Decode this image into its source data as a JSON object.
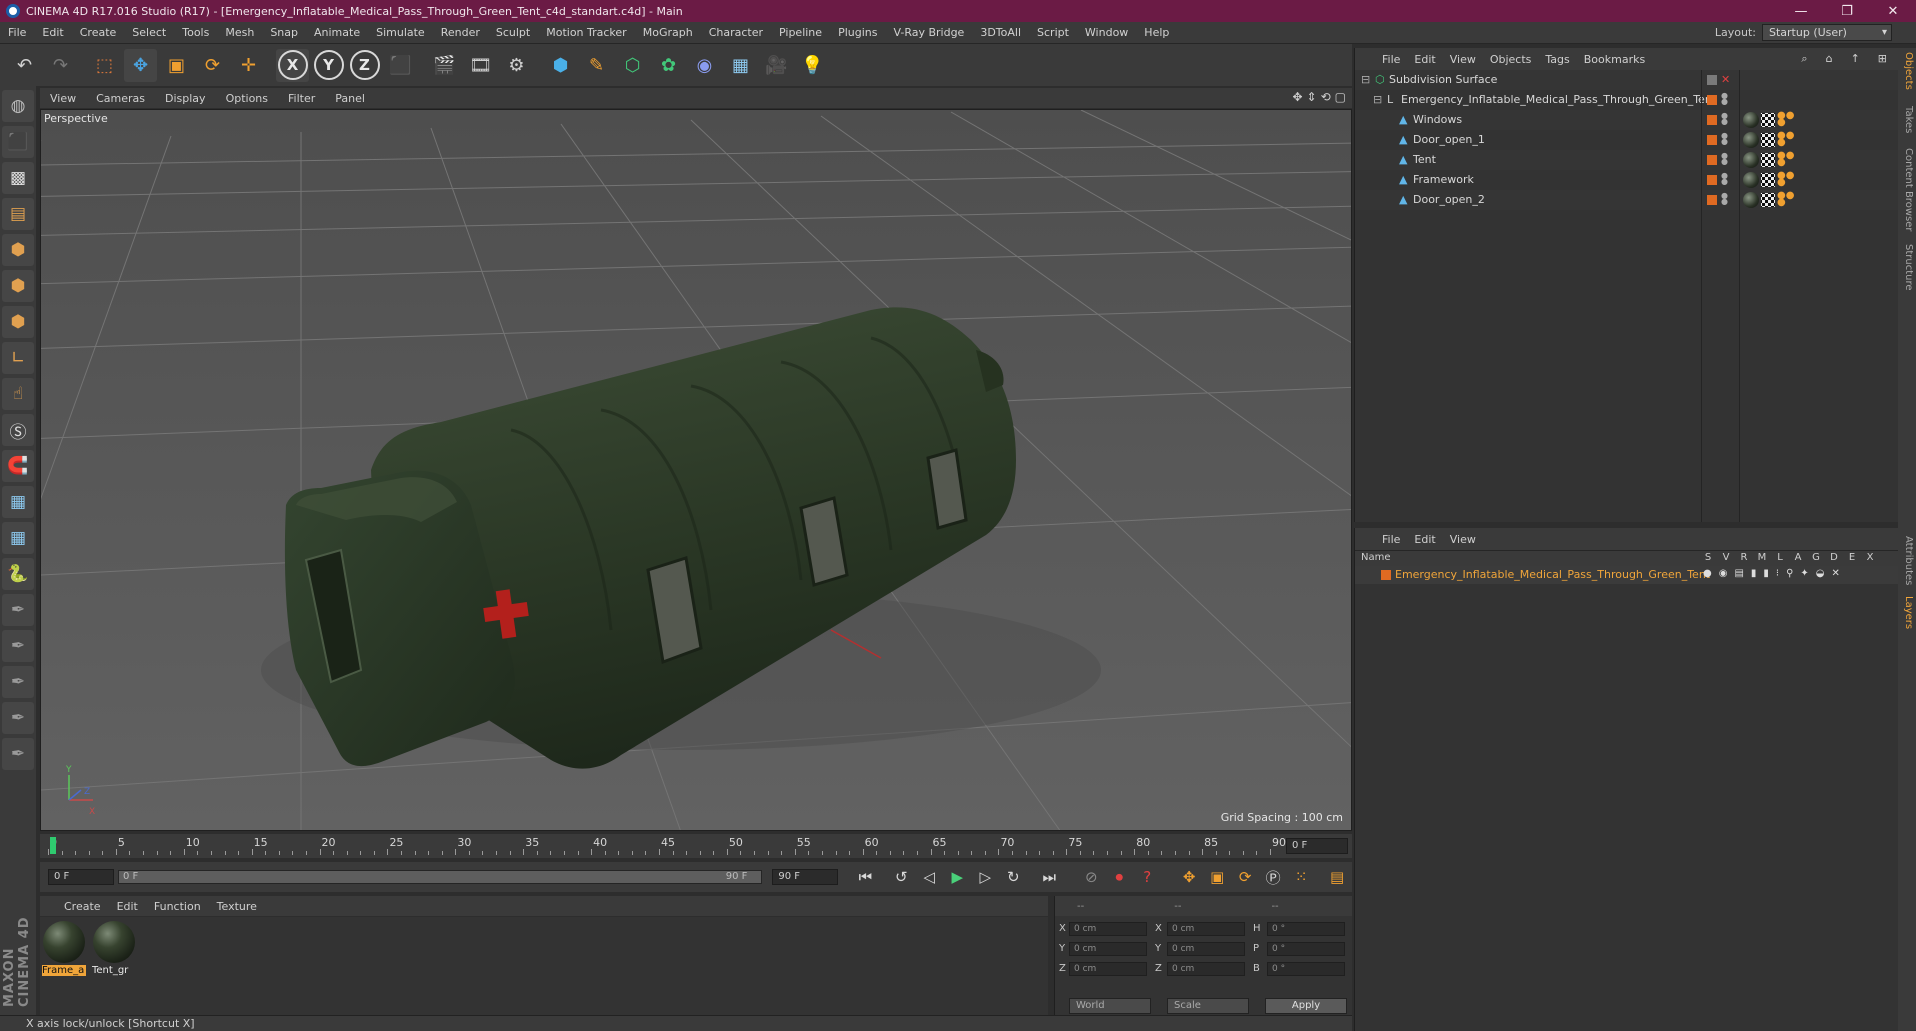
{
  "titlebar": {
    "title": "CINEMA 4D R17.016 Studio (R17) - [Emergency_Inflatable_Medical_Pass_Through_Green_Tent_c4d_standart.c4d] - Main",
    "minimize": "—",
    "maximize": "❐",
    "close": "✕"
  },
  "menubar": {
    "items": [
      "File",
      "Edit",
      "Create",
      "Select",
      "Tools",
      "Mesh",
      "Snap",
      "Animate",
      "Simulate",
      "Render",
      "Sculpt",
      "Motion Tracker",
      "MoGraph",
      "Character",
      "Pipeline",
      "Plugins",
      "V-Ray Bridge",
      "3DToAll",
      "Script",
      "Window",
      "Help"
    ],
    "layout_label": "Layout:",
    "layout_value": "Startup (User)"
  },
  "toolbar": {
    "axis_x": "X",
    "axis_y": "Y",
    "axis_z": "Z"
  },
  "viewport": {
    "menu": [
      "View",
      "Cameras",
      "Display",
      "Options",
      "Filter",
      "Panel"
    ],
    "label": "Perspective",
    "grid_spacing": "Grid Spacing : 100 cm",
    "axis_labels": {
      "y": "Y",
      "x": "X",
      "z": "Z"
    },
    "tent_color": "#2c3a26",
    "background_color": "#5a5a5a"
  },
  "timeline": {
    "ticks": [
      "0",
      "5",
      "10",
      "15",
      "20",
      "25",
      "30",
      "35",
      "40",
      "45",
      "50",
      "55",
      "60",
      "65",
      "70",
      "75",
      "80",
      "85",
      "90"
    ],
    "current_frame": "0 F"
  },
  "transport": {
    "start_field": "0 F",
    "slider_left": "0 F",
    "slider_right": "90 F",
    "end_field": "90 F"
  },
  "materials": {
    "menu": [
      "Create",
      "Edit",
      "Function",
      "Texture"
    ],
    "items": [
      {
        "name": "Frame_a",
        "active": true
      },
      {
        "name": "Tent_gr",
        "active": false
      }
    ]
  },
  "coordinates": {
    "headers": [
      "--",
      "--",
      "--"
    ],
    "rows": [
      {
        "a": "X",
        "av": "0 cm",
        "b": "X",
        "bv": "0 cm",
        "c": "H",
        "cv": "0 °"
      },
      {
        "a": "Y",
        "av": "0 cm",
        "b": "Y",
        "bv": "0 cm",
        "c": "P",
        "cv": "0 °"
      },
      {
        "a": "Z",
        "av": "0 cm",
        "b": "Z",
        "bv": "0 cm",
        "c": "B",
        "cv": "0 °"
      }
    ],
    "space": "World",
    "mode": "Scale",
    "apply": "Apply"
  },
  "statusbar": {
    "text": "X axis lock/unlock [Shortcut X]"
  },
  "object_manager": {
    "menu": [
      "File",
      "Edit",
      "View",
      "Objects",
      "Tags",
      "Bookmarks"
    ],
    "objects": [
      {
        "name": "Subdivision Surface",
        "level": 0
      },
      {
        "name": "Emergency_Inflatable_Medical_Pass_Through_Green_Tent",
        "level": 1
      },
      {
        "name": "Windows",
        "level": 2
      },
      {
        "name": "Door_open_1",
        "level": 2
      },
      {
        "name": "Tent",
        "level": 2
      },
      {
        "name": "Framework",
        "level": 2
      },
      {
        "name": "Door_open_2",
        "level": 2
      }
    ]
  },
  "right_tabs": [
    "Objects",
    "Takes",
    "Content Browser",
    "Structure",
    "Attributes",
    "Layers"
  ],
  "layer_manager": {
    "menu": [
      "File",
      "Edit",
      "View"
    ],
    "header_name": "Name",
    "columns": [
      "S",
      "V",
      "R",
      "M",
      "L",
      "A",
      "G",
      "D",
      "E",
      "X"
    ],
    "layer_name": "Emergency_Inflatable_Medical_Pass_Through_Green_Tent"
  },
  "branding": {
    "logo": "MAXON CINEMA 4D"
  }
}
